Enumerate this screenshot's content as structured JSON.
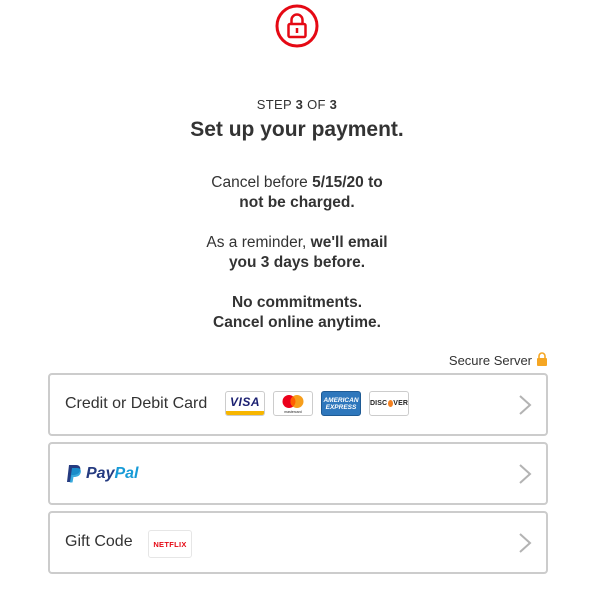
{
  "header": {
    "icon": "lock-icon",
    "accent": "#e50914"
  },
  "step": {
    "prefix": "STEP",
    "current": "3",
    "of": "OF",
    "total": "3"
  },
  "title": "Set up your payment.",
  "notice1": {
    "a": "Cancel before ",
    "b": "5/15/20",
    "c": " to",
    "d": "not be charged."
  },
  "notice2": {
    "a": "As a reminder, ",
    "b": "we'll email",
    "c": "you 3 days before."
  },
  "notice3": {
    "a": "No commitments.",
    "b": "Cancel online anytime."
  },
  "secure": {
    "label": "Secure Server",
    "icon": "lock-icon",
    "color": "#f5a623"
  },
  "options": {
    "card": {
      "label": "Credit or Debit Card",
      "logos": {
        "visa": "VISA",
        "mastercard": "mastercard",
        "amex_line1": "AMERICAN",
        "amex_line2": "EXPRESS",
        "discover_a": "DISC",
        "discover_b": "VER"
      }
    },
    "paypal": {
      "part1": "Pay",
      "part2": "Pal",
      "color1": "#253b80",
      "color2": "#179bd7"
    },
    "gift": {
      "label": "Gift Code",
      "logo": "NETFLIX"
    }
  }
}
